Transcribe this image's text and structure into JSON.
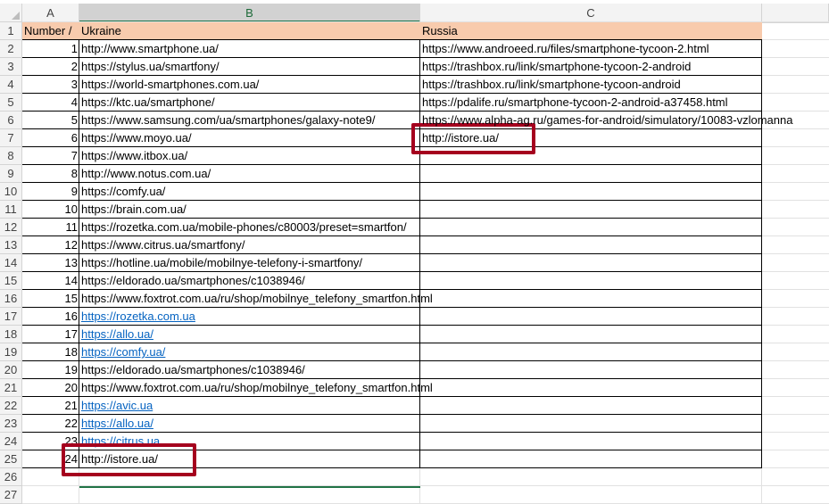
{
  "columns": [
    "A",
    "B",
    "C"
  ],
  "rows": [
    "1",
    "2",
    "3",
    "4",
    "5",
    "6",
    "7",
    "8",
    "9",
    "10",
    "11",
    "12",
    "13",
    "14",
    "15",
    "16",
    "17",
    "18",
    "19",
    "20",
    "21",
    "22",
    "23",
    "24",
    "25",
    "26",
    "27"
  ],
  "header": {
    "number": "Number /",
    "ukraine": "Ukraine",
    "russia": "Russia"
  },
  "ukraine": [
    {
      "n": "1",
      "url": "http://www.smartphone.ua/",
      "link": false
    },
    {
      "n": "2",
      "url": "https://stylus.ua/smartfony/",
      "link": false
    },
    {
      "n": "3",
      "url": "https://world-smartphones.com.ua/",
      "link": false
    },
    {
      "n": "4",
      "url": "https://ktc.ua/smartphone/",
      "link": false
    },
    {
      "n": "5",
      "url": "https://www.samsung.com/ua/smartphones/galaxy-note9/",
      "link": false
    },
    {
      "n": "6",
      "url": "https://www.moyo.ua/",
      "link": false
    },
    {
      "n": "7",
      "url": "https://www.itbox.ua/",
      "link": false
    },
    {
      "n": "8",
      "url": "http://www.notus.com.ua/",
      "link": false
    },
    {
      "n": "9",
      "url": "https://comfy.ua/",
      "link": false
    },
    {
      "n": "10",
      "url": "https://brain.com.ua/",
      "link": false
    },
    {
      "n": "11",
      "url": "https://rozetka.com.ua/mobile-phones/c80003/preset=smartfon/",
      "link": false
    },
    {
      "n": "12",
      "url": "https://www.citrus.ua/smartfony/",
      "link": false
    },
    {
      "n": "13",
      "url": "https://hotline.ua/mobile/mobilnye-telefony-i-smartfony/",
      "link": false
    },
    {
      "n": "14",
      "url": "https://eldorado.ua/smartphones/c1038946/",
      "link": false
    },
    {
      "n": "15",
      "url": "https://www.foxtrot.com.ua/ru/shop/mobilnye_telefony_smartfon.html",
      "link": false
    },
    {
      "n": "16",
      "url": "https://rozetka.com.ua",
      "link": true
    },
    {
      "n": "17",
      "url": "https://allo.ua/",
      "link": true
    },
    {
      "n": "18",
      "url": "https://comfy.ua/",
      "link": true
    },
    {
      "n": "19",
      "url": "https://eldorado.ua/smartphones/c1038946/",
      "link": false
    },
    {
      "n": "20",
      "url": "https://www.foxtrot.com.ua/ru/shop/mobilnye_telefony_smartfon.html",
      "link": false
    },
    {
      "n": "21",
      "url": "https://avic.ua",
      "link": true
    },
    {
      "n": "22",
      "url": "https://allo.ua/",
      "link": true
    },
    {
      "n": "23",
      "url": "https://citrus.ua",
      "link": true
    },
    {
      "n": "24",
      "url": "http://istore.ua/",
      "link": false
    }
  ],
  "russia": [
    "https://www.androeed.ru/files/smartphone-tycoon-2.html",
    "https://trashbox.ru/link/smartphone-tycoon-2-android",
    "https://trashbox.ru/link/smartphone-tycoon-android",
    "https://pdalife.ru/smartphone-tycoon-2-android-a37458.html",
    "https://www.alpha-ag.ru/games-for-android/simulatory/10083-vzlomanna",
    "http://istore.ua/"
  ],
  "colors": {
    "header_fill": "#f8cbad",
    "highlight_box": "#a5001e",
    "link": "#0563c1",
    "selected_col": "#217346"
  }
}
